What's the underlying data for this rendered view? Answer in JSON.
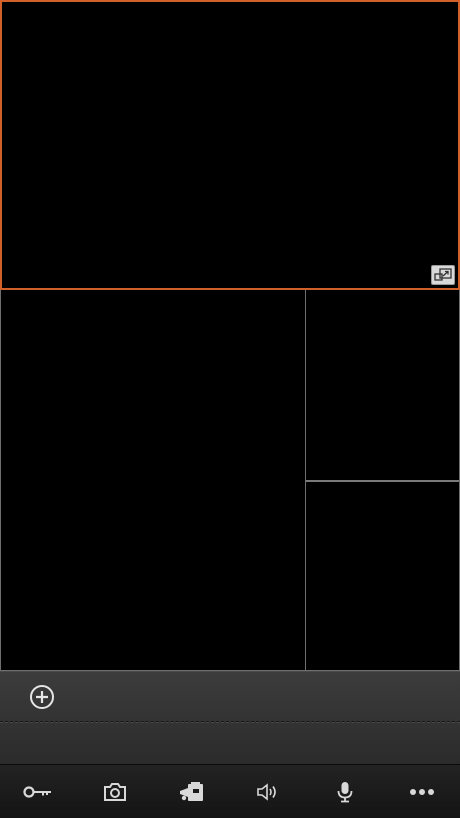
{
  "live_view": {
    "tiles": [
      {
        "id": "tile-1",
        "selected": true
      },
      {
        "id": "tile-2",
        "selected": false
      },
      {
        "id": "tile-3",
        "selected": false
      },
      {
        "id": "tile-4",
        "selected": false
      }
    ],
    "selected_border_color": "#d2602a",
    "fullscreen_icon": "fullscreen-toggle-icon"
  },
  "panel": {
    "add_icon": "plus-circle-icon"
  },
  "toolbar": {
    "items": [
      {
        "icon": "key-icon"
      },
      {
        "icon": "camera-icon"
      },
      {
        "icon": "video-camera-icon"
      },
      {
        "icon": "speaker-icon"
      },
      {
        "icon": "microphone-icon"
      },
      {
        "icon": "more-icon"
      }
    ],
    "icon_color": "#d8d8d8"
  }
}
